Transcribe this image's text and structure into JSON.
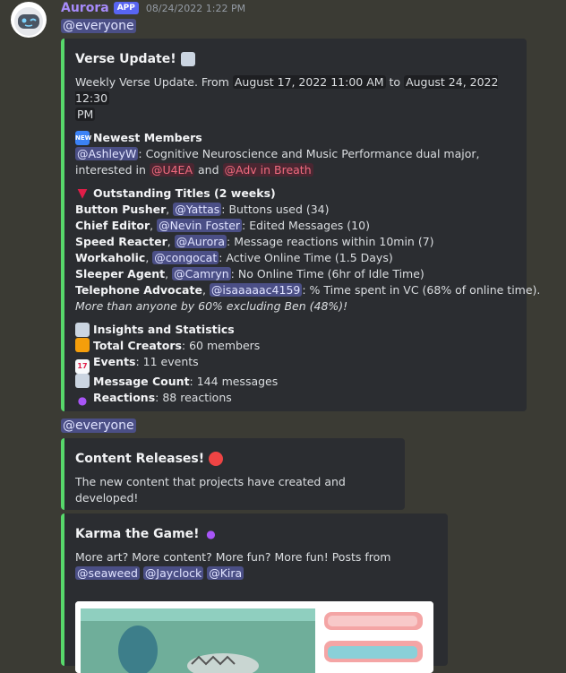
{
  "message": {
    "username": "Aurora",
    "badge": "APP",
    "timestamp": "08/24/2022 1:22 PM",
    "everyone_1": "@everyone",
    "everyone_2": "@everyone"
  },
  "embed1": {
    "title": "Verse Update!",
    "title_icon": "newspaper-icon",
    "intro_text": "Weekly Verse Update. From",
    "from_date": "August 17, 2022 11:00 AM",
    "to_word": "to",
    "to_date_1": "August 24, 2022 12:30",
    "to_date_2": "PM",
    "newest_title": "Newest Members",
    "newest_mention": "@AshleyW",
    "newest_text_1": ": Cognitive Neuroscience and Music Performance dual major,",
    "newest_text_2": "interested in",
    "role_1": "@U4EA",
    "and_word": "and",
    "role_2": "@Adv in Breath",
    "titles_title": "Outstanding Titles (2 weeks)",
    "titles": [
      {
        "name": "Button Pusher",
        "mention": "@Yattas",
        "desc": ": Buttons used (34)"
      },
      {
        "name": "Chief Editor",
        "mention": "@Nevin Foster",
        "desc": ": Edited Messages (10)"
      },
      {
        "name": "Speed Reacter",
        "mention": "@Aurora",
        "desc": ": Message reactions within 10min (7)"
      },
      {
        "name": "Workaholic",
        "mention": "@congocat",
        "desc": ": Active Online Time (1.5 Days)"
      },
      {
        "name": "Sleeper Agent",
        "mention": "@Camryn",
        "desc": ": No Online Time (6hr of Idle Time)"
      },
      {
        "name": "Telephone Advocate",
        "mention": "@isaaaaac4159",
        "desc": ": % Time spent in VC (68% of online time)."
      }
    ],
    "italic_note": "More than anyone by 60% excluding Ben (48%)!",
    "stats_title": "Insights and Statistics",
    "stats": [
      {
        "label": "Total Creators",
        "value": ": 60 members"
      },
      {
        "label": "Events",
        "value": ": 11 events"
      },
      {
        "label": "Message Count",
        "value": ": 144 messages"
      },
      {
        "label": "Reactions",
        "value": ": 88 reactions"
      }
    ]
  },
  "embed2": {
    "title": "Content Releases!",
    "desc": "The new content that projects have created and developed!"
  },
  "embed3": {
    "title": "Karma the Game!",
    "desc": "More art? More content? More fun? More fun! Posts from",
    "mentions": [
      "@seaweed",
      "@Jayclock",
      "@Kira"
    ]
  },
  "colors": {
    "embed_accent": "#57d86b",
    "username": "#a78bfa",
    "mention_bg": "#4b4f86",
    "role_mention": "#f06a7e"
  }
}
